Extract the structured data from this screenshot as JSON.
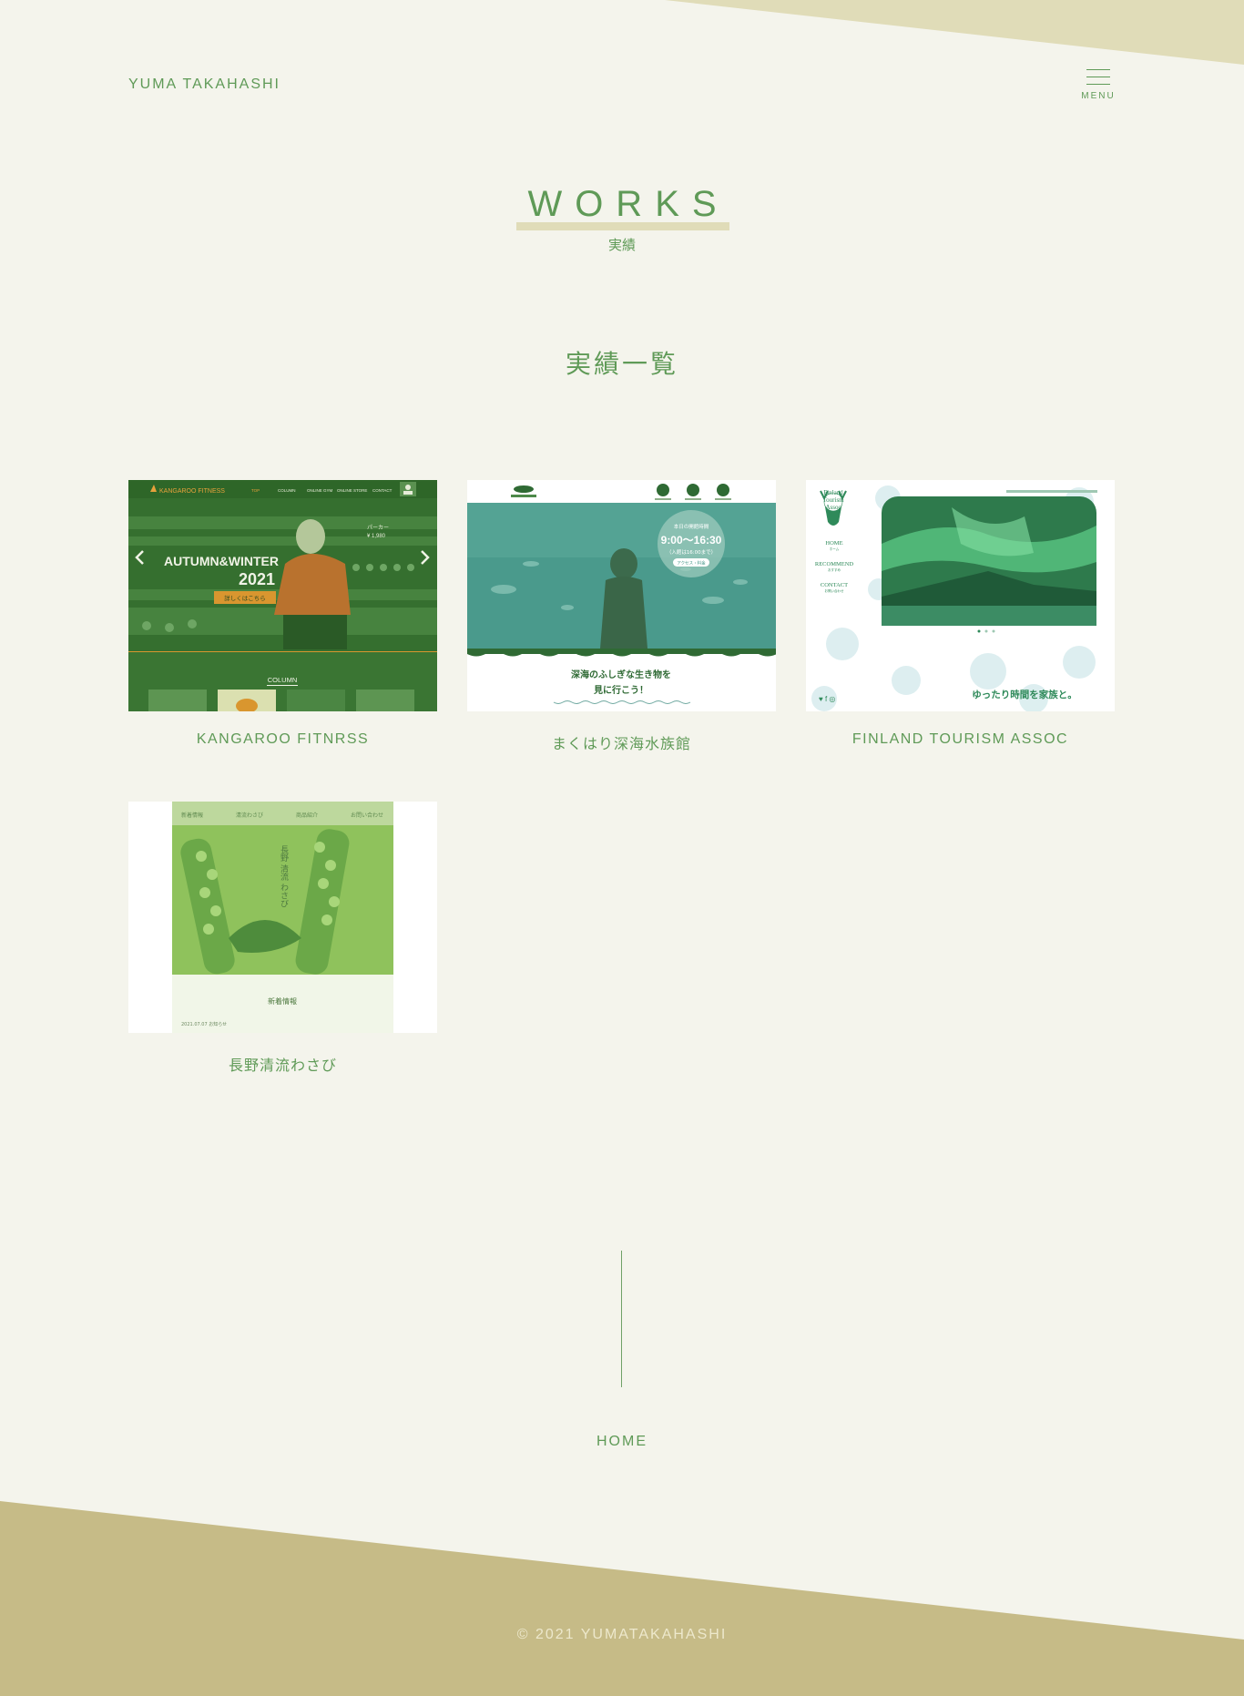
{
  "header": {
    "logo": "YUMA TAKAHASHI",
    "menu_label": "MENU"
  },
  "page": {
    "title": "WORKS",
    "subtitle": "実績",
    "section_heading": "実績一覧"
  },
  "works": [
    {
      "caption": "KANGAROO FITNRSS",
      "thumb": {
        "brand": "KANGAROO FITNESS",
        "nav": [
          "TOP",
          "COLUMN",
          "ONLINE GYM",
          "ONLINE STORE",
          "CONTACT"
        ],
        "headline": "AUTUMN&WINTER",
        "year": "2021",
        "cta": "詳しくはこちら",
        "price_label": "パーカー",
        "price": "¥ 1,980",
        "section": "COLUMN"
      }
    },
    {
      "caption": "まくはり深海水族館",
      "thumb": {
        "hours_label": "本日の開館時間",
        "hours": "9:00〜16:30",
        "hours_note": "（入館は16:00まで）",
        "hours_button": "アクセス・料金",
        "headline_line1": "深海のふしぎな生き物を",
        "headline_line2": "見に行こう！"
      }
    },
    {
      "caption": "FINLAND TOURISM ASSOC",
      "thumb": {
        "logo_line1": "Finland",
        "logo_line2": "Tourism",
        "logo_line3": "Assoc",
        "nav": [
          {
            "en": "HOME",
            "jp": "ホーム"
          },
          {
            "en": "RECOMMEND",
            "jp": "おすすめ"
          },
          {
            "en": "CONTACT",
            "jp": "お問い合わせ"
          }
        ],
        "tagline": "ゆったり時間を家族と。"
      }
    },
    {
      "caption": "長野清流わさび",
      "thumb": {
        "nav": [
          "新着情報",
          "清流わさび",
          "商品紹介",
          "お問い合わせ"
        ],
        "vertical_title": "長野 清流 わさび",
        "section": "新着情報",
        "news_date": "2021.07.07 お知らせ"
      }
    }
  ],
  "footer": {
    "home_label": "HOME",
    "copyright": "© 2021 YUMATAKAHASHI"
  },
  "colors": {
    "background": "#f4f4ec",
    "accent_green": "#5f9a57",
    "top_band": "#e0dcb8",
    "bottom_band": "#c6bb87"
  }
}
